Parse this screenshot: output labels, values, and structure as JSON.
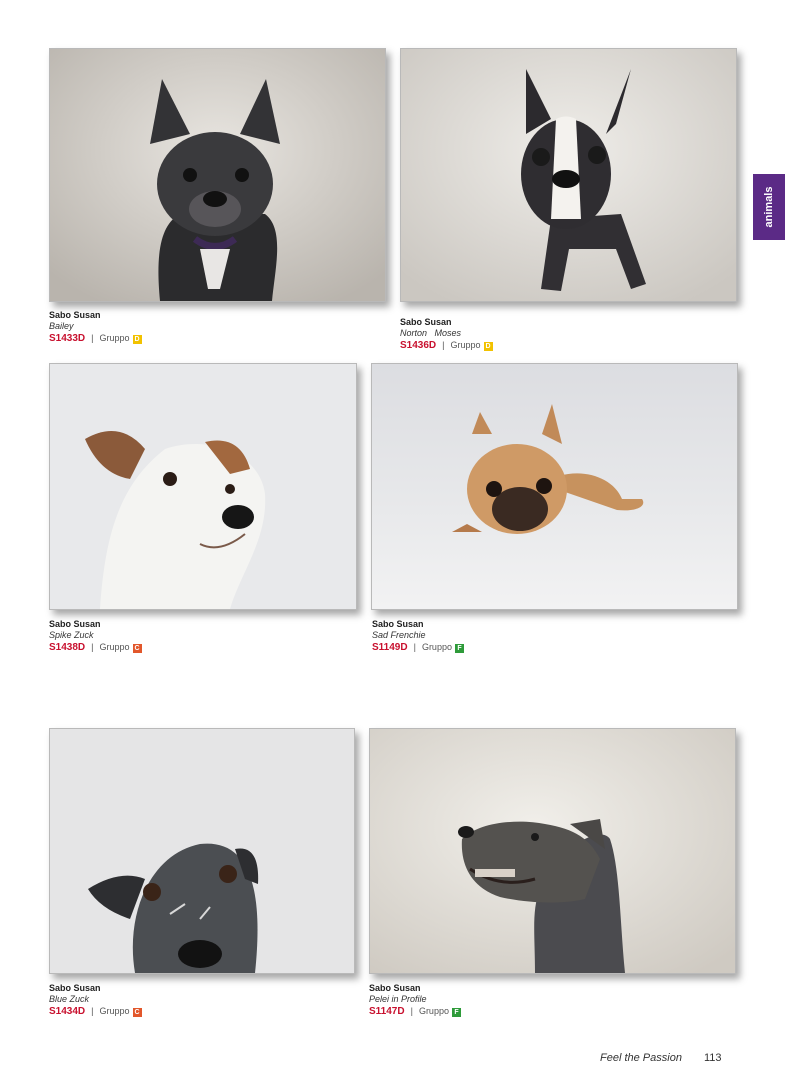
{
  "side_tab": {
    "label": "animals",
    "color": "#5b2a86"
  },
  "footer": {
    "slogan": "Feel the Passion",
    "page_number": "113"
  },
  "badge_colors": {
    "D": "#f2c200",
    "C": "#e2572b",
    "F": "#2e9b3a"
  },
  "items": [
    {
      "artist": "Sabo Susan",
      "title": "Bailey",
      "code": "S1433D",
      "group_label": "Gruppo",
      "group": "D"
    },
    {
      "artist": "Sabo Susan",
      "title": "Norton   Moses",
      "code": "S1436D",
      "group_label": "Gruppo",
      "group": "D"
    },
    {
      "artist": "Sabo Susan",
      "title": "Spike Zuck",
      "code": "S1438D",
      "group_label": "Gruppo",
      "group": "C"
    },
    {
      "artist": "Sabo Susan",
      "title": "Sad Frenchie",
      "code": "S1149D",
      "group_label": "Gruppo",
      "group": "F"
    },
    {
      "artist": "Sabo Susan",
      "title": "Blue Zuck",
      "code": "S1434D",
      "group_label": "Gruppo",
      "group": "C"
    },
    {
      "artist": "Sabo Susan",
      "title": "Pelei in Profile",
      "code": "S1147D",
      "group_label": "Gruppo",
      "group": "F"
    }
  ]
}
